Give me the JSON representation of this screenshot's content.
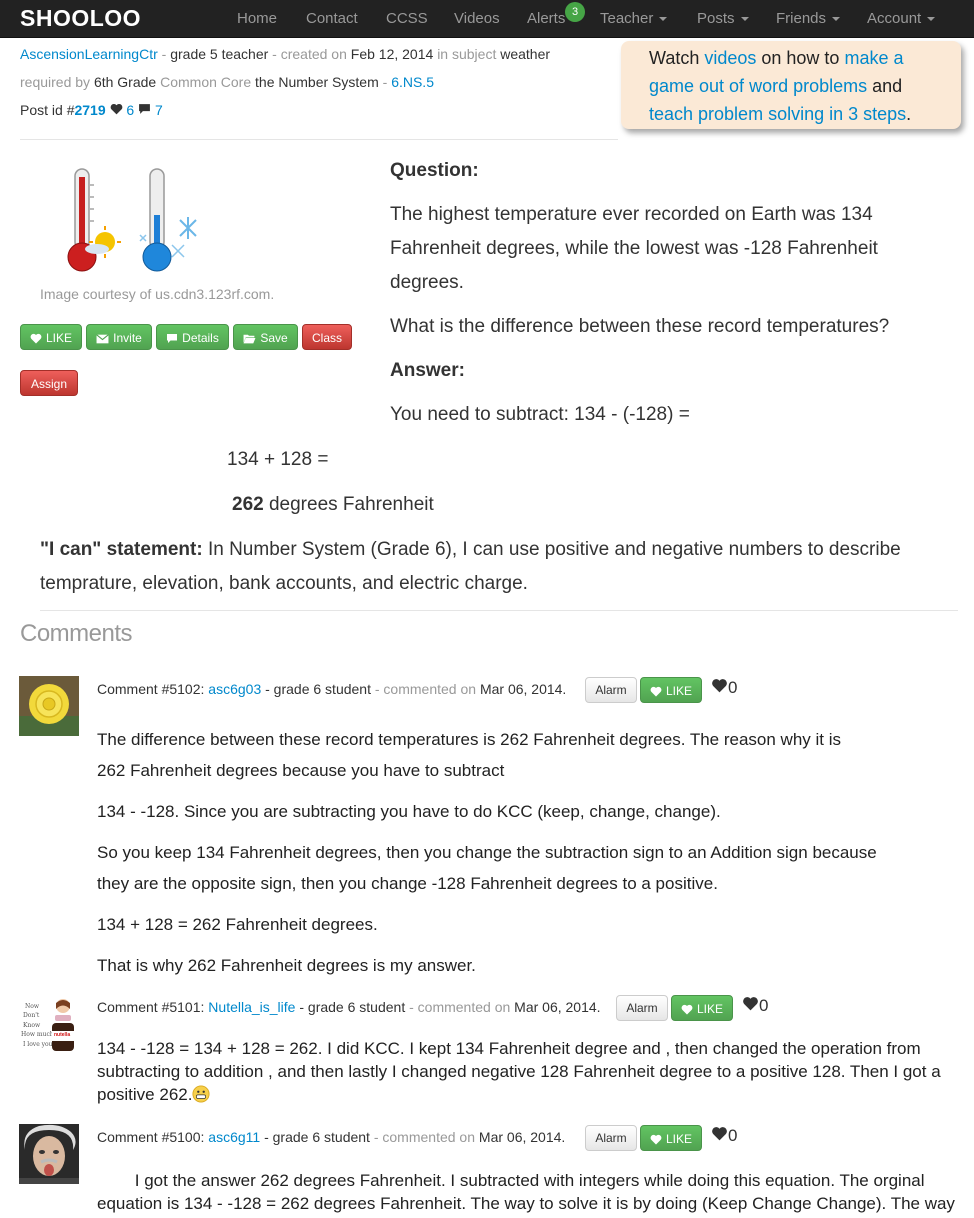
{
  "nav": {
    "brand": "SHOOLOO",
    "items": [
      "Home",
      "Contact",
      "CCSS",
      "Videos",
      "Alerts",
      "Teacher",
      "Posts",
      "Friends",
      "Account"
    ],
    "alerts_badge": "3"
  },
  "post": {
    "author": "AscensionLearningCtr",
    "author_role": "grade 5 teacher",
    "created_label": "- created on",
    "created_date": "Feb 12, 2014",
    "subject_label": "in subject",
    "subject": "weather",
    "required_label": "required by",
    "required_grade": "6th Grade",
    "standard_area": "Common Core",
    "standard_area2": "the Number System",
    "standard_code": "6.NS.5",
    "post_id_label": "Post id #",
    "post_id": "2719",
    "likes": "6",
    "comments_count": "7"
  },
  "callout": {
    "t1": "Watch ",
    "l1": "videos",
    "t2": " on how to ",
    "l2": "make a game out of word problems",
    "t3": " and ",
    "l3": "teach problem solving in 3 steps",
    "t4": "."
  },
  "image": {
    "caption": "Image courtesy of us.cdn3.123rf.com."
  },
  "buttons": {
    "like": "LIKE",
    "invite": "Invite",
    "details": "Details",
    "save": "Save",
    "class": "Class",
    "assign": "Assign"
  },
  "question": {
    "heading": "Question:",
    "line1": "The highest temperature ever recorded on Earth was 134",
    "line2": "Fahrenheit degrees, while the lowest was -128 Fahrenheit",
    "line3": "degrees.",
    "line4": "What is the difference between these record temperatures?"
  },
  "answer": {
    "heading": "Answer:",
    "line1": "You need to subtract: 134 - (-128) =",
    "line2": "134 + 128 =",
    "result_bold": "262",
    "result_rest": " degrees Fahrenheit"
  },
  "ican": {
    "label": "\"I can\" statement:",
    "line1": " In Number System (Grade 6), I can use positive and negative numbers to describe",
    "line2": "temprature, elevation, bank accounts, and electric charge."
  },
  "comments_title": "Comments",
  "comments": [
    {
      "id_label": "Comment #5102:",
      "user": "asc6g03",
      "role": "- grade 6 student",
      "commented": "- commented on",
      "date": "Mar 06, 2014.",
      "alarm": "Alarm",
      "like": "LIKE",
      "likes": "0",
      "lines": [
        "The difference between these record temperatures is 262 Fahrenheit degrees. The reason why it is",
        "262 Fahrenheit degrees because you have to subtract",
        "134 - -128. Since you are subtracting you have to do KCC (keep, change, change).",
        "So you keep 134 Fahrenheit degrees, then you change the subtraction sign to an Addition sign because",
        "they are the opposite sign, then you change -128  Fahrenheit degrees to a positive.",
        "134 + 128 =  262 Fahrenheit degrees.",
        "That is why 262 Fahrenheit degrees is my answer."
      ]
    },
    {
      "id_label": "Comment #5101:",
      "user": "Nutella_is_life",
      "role": "- grade 6 student",
      "commented": "- commented on",
      "date": "Mar 06, 2014.",
      "alarm": "Alarm",
      "like": "LIKE",
      "likes": "0",
      "lines": [
        "134 - -128 = 134 + 128 = 262. I did KCC. I kept 134 Fahrenheit degree and , then changed the operation from",
        "subtracting to addition , and then lastly I changed negative 128 Fahrenheit degree to a positive 128. Then I got a",
        "positive 262."
      ],
      "avatar_text": [
        "Now",
        "Don't",
        "Know",
        "How much",
        "I love you",
        "nutella"
      ]
    },
    {
      "id_label": "Comment #5100:",
      "user": "asc6g11",
      "role": "- grade 6 student",
      "commented": "- commented on",
      "date": "Mar 06, 2014.",
      "alarm": "Alarm",
      "like": "LIKE",
      "likes": "0",
      "lines": [
        "        I got the answer 262 degrees Fahrenheit. I subtracted with integers while doing this equation. The orginal",
        "equation is 134 - -128 = 262 degrees Fahrenheit. The way to solve it is by doing (Keep Change Change). The way"
      ]
    }
  ],
  "colors": {
    "nav_bg": "#222222",
    "link": "#0088cc",
    "green": "#5bb75b",
    "red": "#da4f49",
    "callout_bg": "#fbe9d6"
  }
}
